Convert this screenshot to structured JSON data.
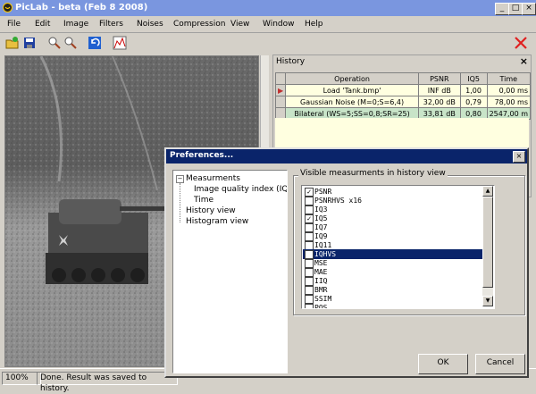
{
  "app": {
    "title": "PicLab - beta (Feb  8 2008)"
  },
  "menu": [
    "File",
    "Edit",
    "Image",
    "Filters",
    "Noises",
    "Compression",
    "View",
    "Window",
    "Help"
  ],
  "toolbar": [
    "open-icon",
    "save-icon",
    "zoom-in-icon",
    "zoom-out-icon",
    "undo-icon",
    "histogram-icon",
    "close-icon"
  ],
  "history": {
    "title": "History",
    "columns": [
      "Operation",
      "PSNR",
      "IQ5",
      "Time"
    ],
    "rows": [
      {
        "op": "Load 'Tank.bmp'",
        "psnr": "INF dB",
        "iq5": "1,00",
        "time": "0,00 ms",
        "bg": "#ffffe0"
      },
      {
        "op": "Gaussian Noise (M=0;S=6,4)",
        "psnr": "32,00 dB",
        "iq5": "0,79",
        "time": "78,00 ms",
        "bg": "#ffffe0"
      },
      {
        "op": "Bilateral (WS=5;SS=0,8;SR=25)",
        "psnr": "33,81 dB",
        "iq5": "0,80",
        "time": "2547,00 m",
        "bg": "#c8e4c8"
      }
    ]
  },
  "status": {
    "zoom": "100%",
    "message": "Done. Result was saved to history."
  },
  "dialog": {
    "title": "Preferences...",
    "tree": {
      "root": "Measurments",
      "children": [
        "Image quality index (IQ-S",
        "Time"
      ],
      "others": [
        "History view",
        "Histogram view"
      ]
    },
    "group_label": "Visible measurments in history view",
    "items": [
      {
        "label": "PSNR",
        "checked": true,
        "selected": false
      },
      {
        "label": "PSNRHVS x16",
        "checked": false,
        "selected": false
      },
      {
        "label": "IQ3",
        "checked": false,
        "selected": false
      },
      {
        "label": "IQ5",
        "checked": true,
        "selected": false
      },
      {
        "label": "IQ7",
        "checked": false,
        "selected": false
      },
      {
        "label": "IQ9",
        "checked": false,
        "selected": false
      },
      {
        "label": "IQ11",
        "checked": false,
        "selected": false
      },
      {
        "label": "IQHVS",
        "checked": false,
        "selected": true
      },
      {
        "label": "MSE",
        "checked": false,
        "selected": false
      },
      {
        "label": "MAE",
        "checked": false,
        "selected": false
      },
      {
        "label": "IIQ",
        "checked": false,
        "selected": false
      },
      {
        "label": "BMR",
        "checked": false,
        "selected": false
      },
      {
        "label": "SSIM",
        "checked": false,
        "selected": false
      },
      {
        "label": "POS",
        "checked": false,
        "selected": false
      }
    ],
    "ok": "OK",
    "cancel": "Cancel"
  }
}
